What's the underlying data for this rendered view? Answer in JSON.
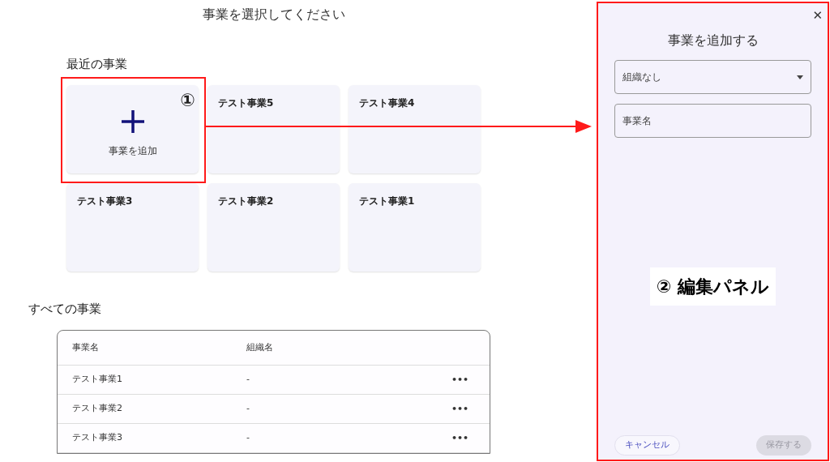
{
  "page": {
    "title": "事業を選択してください"
  },
  "recent": {
    "heading": "最近の事業",
    "add_card": {
      "label": "事業を追加"
    },
    "cards": [
      {
        "name": "テスト事業5"
      },
      {
        "name": "テスト事業4"
      },
      {
        "name": "テスト事業3"
      },
      {
        "name": "テスト事業2"
      },
      {
        "name": "テスト事業1"
      }
    ]
  },
  "all": {
    "heading": "すべての事業",
    "table": {
      "columns": [
        "事業名",
        "組織名"
      ],
      "rows": [
        {
          "cells": [
            "テスト事業1",
            "-"
          ],
          "menu": "•••"
        },
        {
          "cells": [
            "テスト事業2",
            "-"
          ],
          "menu": "•••"
        },
        {
          "cells": [
            "テスト事業3",
            "-"
          ],
          "menu": "•••"
        }
      ]
    }
  },
  "panel": {
    "close": "✕",
    "title": "事業を追加する",
    "select": {
      "value": "組織なし"
    },
    "name_field": {
      "placeholder": "事業名"
    },
    "buttons": [
      {
        "label": "キャンセル",
        "kind": "outline",
        "disabled": false
      },
      {
        "label": "保存する",
        "kind": "filled",
        "disabled": true
      }
    ]
  },
  "annotations": {
    "badge": "①",
    "panel_label": "② 編集パネル"
  }
}
